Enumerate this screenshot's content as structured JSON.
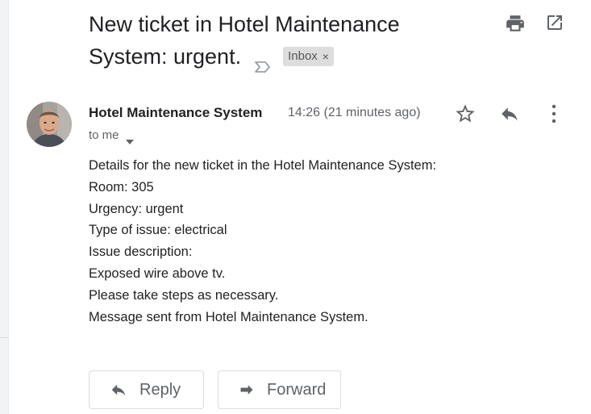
{
  "email": {
    "subject_line1": "New ticket in Hotel Maintenance",
    "subject_line2": "System: urgent.",
    "label": "Inbox",
    "label_remove": "×",
    "sender": "Hotel Maintenance System",
    "timestamp": "14:26 (21 minutes ago)",
    "recipient": "to me",
    "body": [
      "Details for the new ticket in the Hotel Maintenance System:",
      "Room: 305",
      "Urgency: urgent",
      "Type of issue: electrical",
      "Issue description:",
      "Exposed wire above tv.",
      "Please take steps as necessary.",
      "Message sent from Hotel Maintenance System."
    ]
  },
  "actions": {
    "reply_label": "Reply",
    "forward_label": "Forward"
  },
  "icons": {
    "print": "print-icon",
    "open_new_window": "open-in-new-icon",
    "importance": "importance-marker-icon",
    "star": "star-icon",
    "reply": "reply-icon",
    "more": "more-vertical-icon",
    "caret": "chevron-down-icon",
    "forward": "forward-icon"
  },
  "colors": {
    "text": "#202124",
    "secondary_text": "#5f6368",
    "icon": "#5f6368",
    "label_chip_bg": "#dddddd"
  }
}
